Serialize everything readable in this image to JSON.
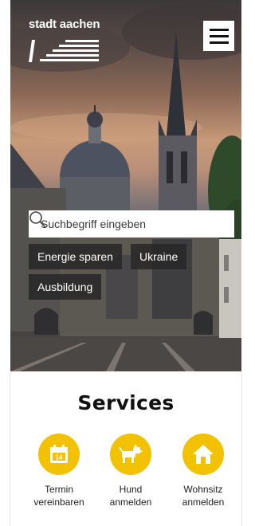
{
  "site": {
    "logo_text": "stadt aachen"
  },
  "header": {
    "menu_icon": "hamburger-menu-icon"
  },
  "search": {
    "placeholder": "Suchbegriff eingeben",
    "icon": "search-icon"
  },
  "quick_links": [
    {
      "label": "Energie sparen"
    },
    {
      "label": "Ukraine"
    },
    {
      "label": "Ausbildung"
    }
  ],
  "services": {
    "title": "Services",
    "items": [
      {
        "label": "Termin\nvereinbaren",
        "icon": "calendar-icon"
      },
      {
        "label": "Hund\nanmelden",
        "icon": "dog-icon"
      },
      {
        "label": "Wohnsitz\nanmelden",
        "icon": "house-icon"
      }
    ]
  },
  "colors": {
    "accent": "#f2c100",
    "chip_bg": "#2a2a2a",
    "text_dark": "#111111"
  }
}
